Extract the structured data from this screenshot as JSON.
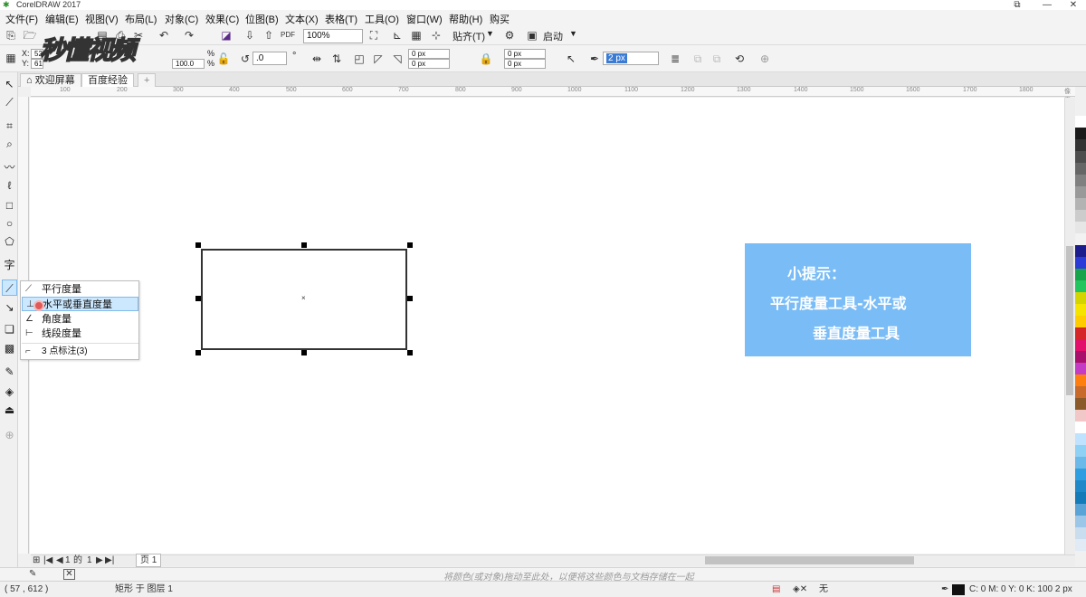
{
  "window": {
    "title": "CorelDRAW 2017",
    "controls": [
      "⧉",
      "—",
      "✕"
    ]
  },
  "menu": [
    "文件(F)",
    "编辑(E)",
    "视图(V)",
    "布局(L)",
    "对象(C)",
    "效果(C)",
    "位图(B)",
    "文本(X)",
    "表格(T)",
    "工具(O)",
    "窗口(W)",
    "帮助(H)",
    "购买"
  ],
  "toolbar1": {
    "zoom_value": "100%",
    "snap_label": "贴齐(T)",
    "launch_label": "启动"
  },
  "toolbar2": {
    "x_label": "X:",
    "x_value": "52",
    "y_label": "Y:",
    "y_value": "61",
    "percent1": "%",
    "percent2": "%",
    "scale_value": "100.0",
    "rotation_value": ".0",
    "degree": "°",
    "corner_tl": "0 px",
    "corner_bl": "0 px",
    "corner_tr": "0 px",
    "corner_br": "0 px",
    "outline_width": "2 px"
  },
  "doc_tabs": {
    "welcome": "欢迎屏幕",
    "doc": "百度经验",
    "add": "+"
  },
  "ruler_ticks": [
    "100",
    "200",
    "300",
    "400",
    "500",
    "600",
    "700",
    "800",
    "900",
    "1000",
    "1100",
    "1200",
    "1300",
    "1400",
    "1500",
    "1600",
    "1700",
    "1800"
  ],
  "ruler_unit": "像素",
  "flyout": {
    "items": [
      {
        "icon": "parallel-dimension-icon",
        "glyph": "⟋",
        "label": "平行度量"
      },
      {
        "icon": "horizontal-vertical-dimension-icon",
        "glyph": "⊥",
        "label": "水平或垂直度量"
      },
      {
        "icon": "angular-dimension-icon",
        "glyph": "∠",
        "label": "角度量"
      },
      {
        "icon": "segment-dimension-icon",
        "glyph": "⊢",
        "label": "线段度量"
      },
      {
        "icon": "three-point-callout-icon",
        "glyph": "⌐",
        "label": "3 点标注(3)"
      }
    ],
    "selected_index": 1
  },
  "watermark": "秒懂视频",
  "tip": {
    "title": "小提示：",
    "line1": "平行度量工具-水平或",
    "line2": "垂直度量工具"
  },
  "page_nav": {
    "first": "|◀",
    "prev": "◀",
    "current": "1",
    "of": "的",
    "total": "1",
    "next": "▶",
    "last": "▶|",
    "page_tab": "页 1"
  },
  "color_bar_hint": "将颜色(或对象)拖动至此处，以便将这些颜色与文档存储在一起",
  "status": {
    "coords": "( 57 , 612 )",
    "object_info": "矩形 于 图层 1",
    "fill_none": "无",
    "outline_info": "C: 0 M: 0 Y: 0 K: 100  2 px"
  },
  "palette_colors": [
    "#ffffff",
    "#1a1a1a",
    "#333333",
    "#4d4d4d",
    "#666666",
    "#808080",
    "#999999",
    "#b3b3b3",
    "#cccccc",
    "#e6e6e6",
    "#f2f2f2",
    "#1c1c8c",
    "#2b3bd6",
    "#16a34a",
    "#22c55e",
    "#d4d400",
    "#f5e400",
    "#ffcc00",
    "#d62728",
    "#e3106b",
    "#a8106b",
    "#c43cc4",
    "#ff7f0e",
    "#c76a2a",
    "#8b5a2b",
    "#f2c7c7",
    "#ffffff",
    "#bfe3ff",
    "#8fd0f5",
    "#6ab9e8",
    "#2f9ee0",
    "#1e88c9",
    "#147ab8",
    "#5aa3d6",
    "#9cc6e8",
    "#c9ddef",
    "#e1ebf5"
  ],
  "colors": {
    "tip_bg": "#79bcf6",
    "selection_bg": "#cce8ff"
  }
}
